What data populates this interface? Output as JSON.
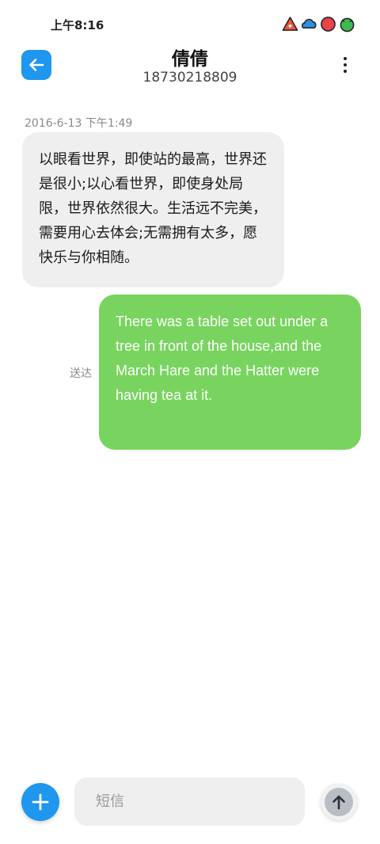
{
  "status_bar": {
    "time": "上午8:16",
    "icons": [
      "warning-triangle-icon",
      "cloud-icon",
      "heart-icon",
      "robot-icon"
    ],
    "icon_colors": [
      "#f0553a",
      "#2a8fe0",
      "#e8424a",
      "#3cba4c"
    ]
  },
  "header": {
    "back_icon": "arrow-left-icon",
    "contact_name": "倩倩",
    "phone_number": "18730218809",
    "more_icon": "vertical-dots-icon"
  },
  "conversation": {
    "timestamp": "2016-6-13 下午1:49",
    "messages": [
      {
        "direction": "incoming",
        "text": "以眼看世界，即使站的最高，世界还是很小;以心看世界，即使身处局限，世界依然很大。生活远不完美，需要用心去体会;无需拥有太多，愿快乐与你相随。"
      },
      {
        "direction": "outgoing",
        "text": "There was a table set out under a tree in front of the house,and the March Hare and the Hatter were having tea at it.",
        "status": "送达"
      }
    ]
  },
  "composer": {
    "add_icon": "plus-icon",
    "placeholder": "短信",
    "value": "",
    "send_icon": "arrow-up-icon"
  },
  "colors": {
    "accent": "#1f97ee",
    "outgoing_bubble": "#78d45e",
    "incoming_bubble": "#efefef"
  }
}
